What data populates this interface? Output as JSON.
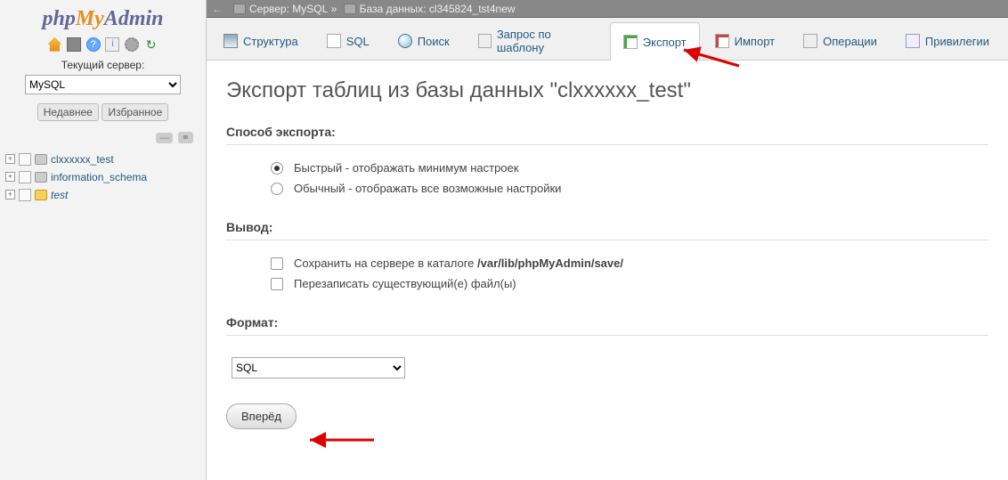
{
  "logo": {
    "part1": "php",
    "part2": "My",
    "part3": "Admin"
  },
  "sidebar": {
    "current_server_label": "Текущий сервер:",
    "server_selected": "MySQL",
    "recent_label": "Недавнее",
    "favorites_label": "Избранное"
  },
  "dbtree": [
    {
      "name": "clxxxxxx_test",
      "italic": false,
      "new": false
    },
    {
      "name": "information_schema",
      "italic": false,
      "new": false
    },
    {
      "name": "test",
      "italic": true,
      "new": true
    }
  ],
  "breadcrumb": {
    "server_prefix": "Сервер:",
    "server_name": "MySQL",
    "sep": "»",
    "db_prefix": "База данных:",
    "db_name": "cl345824_tst4new"
  },
  "tabs": [
    {
      "key": "structure",
      "label": "Структура",
      "icon": "ic-struct",
      "active": false
    },
    {
      "key": "sql",
      "label": "SQL",
      "icon": "ic-sql",
      "active": false
    },
    {
      "key": "search",
      "label": "Поиск",
      "icon": "ic-search",
      "active": false
    },
    {
      "key": "query",
      "label": "Запрос по шаблону",
      "icon": "ic-query",
      "active": false
    },
    {
      "key": "export",
      "label": "Экспорт",
      "icon": "ic-export",
      "active": true
    },
    {
      "key": "import",
      "label": "Импорт",
      "icon": "ic-import",
      "active": false
    },
    {
      "key": "operations",
      "label": "Операции",
      "icon": "ic-ops",
      "active": false
    },
    {
      "key": "privileges",
      "label": "Привилегии",
      "icon": "ic-priv",
      "active": false
    }
  ],
  "page": {
    "title": "Экспорт таблиц из базы данных \"clxxxxxx_test\"",
    "export_method_title": "Способ экспорта:",
    "method_quick": "Быстрый - отображать минимум настроек",
    "method_custom": "Обычный - отображать все возможные настройки",
    "output_title": "Вывод:",
    "save_label_prefix": "Сохранить на сервере в каталоге ",
    "save_path": "/var/lib/phpMyAdmin/save/",
    "overwrite_label": "Перезаписать существующий(е) файл(ы)",
    "format_title": "Формат:",
    "format_selected": "SQL",
    "go_button": "Вперёд"
  }
}
